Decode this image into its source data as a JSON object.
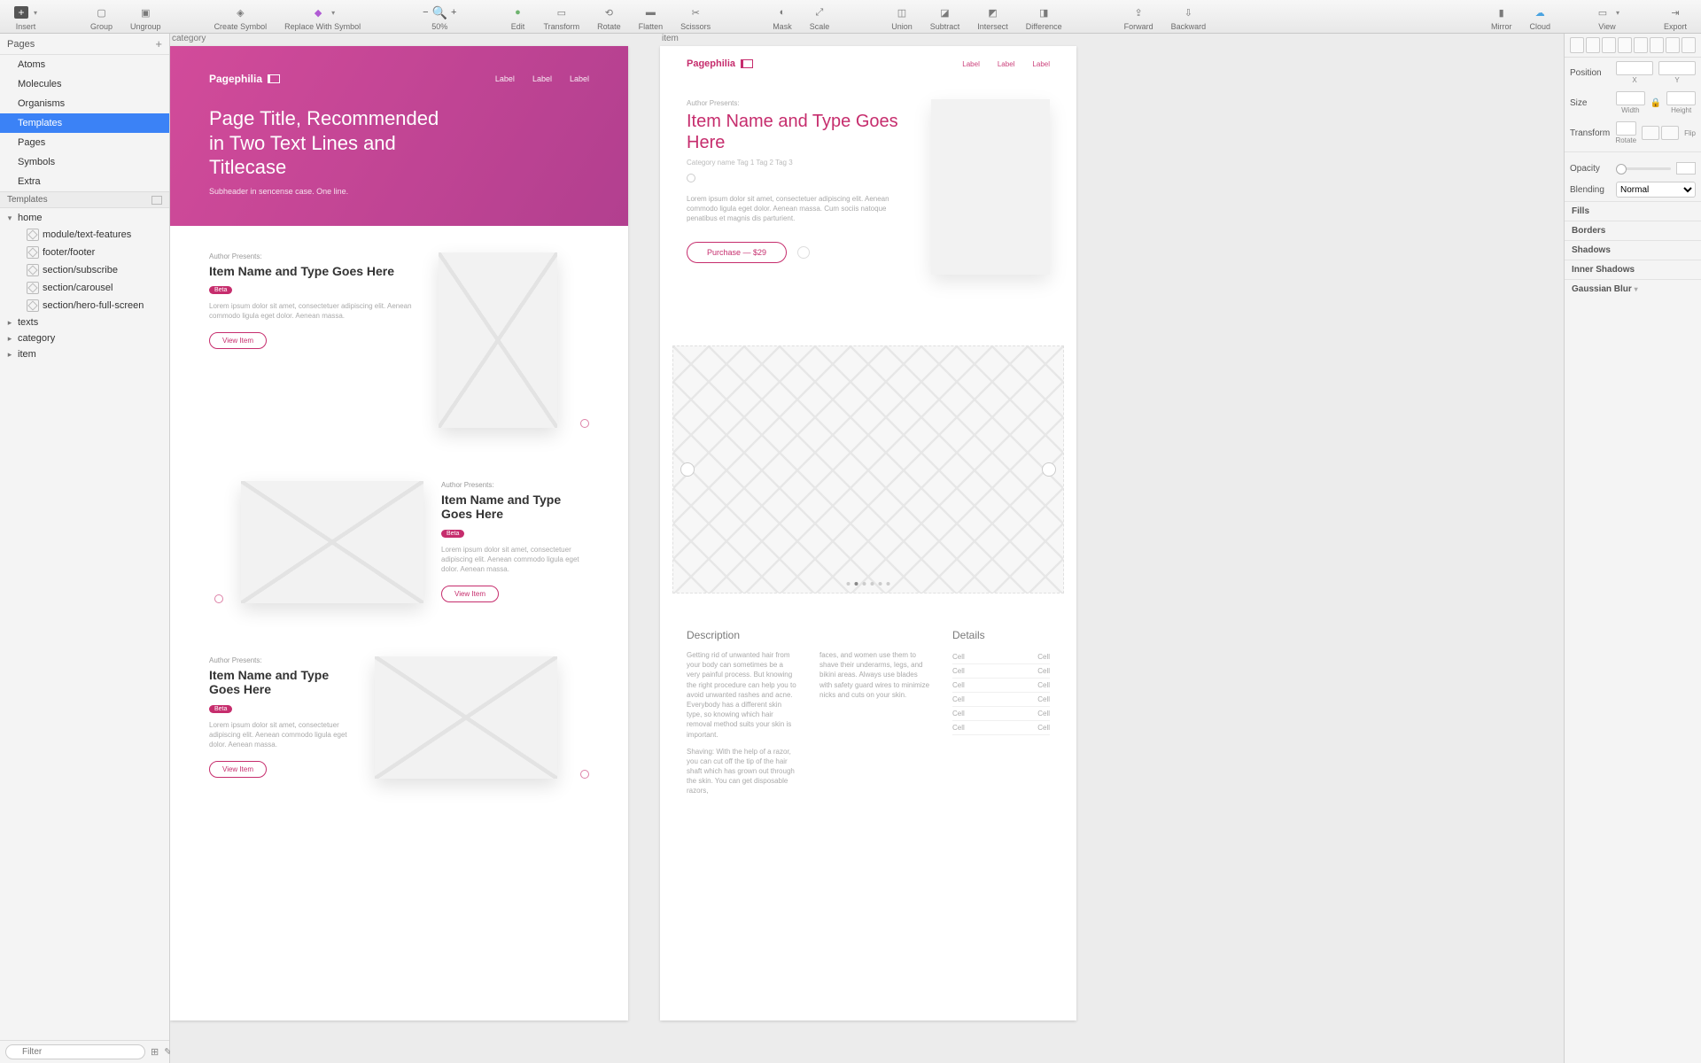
{
  "toolbar": {
    "insert": "Insert",
    "group": "Group",
    "ungroup": "Ungroup",
    "create_symbol": "Create Symbol",
    "replace_symbol": "Replace With Symbol",
    "zoom": "50%",
    "edit": "Edit",
    "transform": "Transform",
    "rotate": "Rotate",
    "flatten": "Flatten",
    "scissors": "Scissors",
    "mask": "Mask",
    "scale": "Scale",
    "union": "Union",
    "subtract": "Subtract",
    "intersect": "Intersect",
    "difference": "Difference",
    "forward": "Forward",
    "backward": "Backward",
    "mirror": "Mirror",
    "cloud": "Cloud",
    "view": "View",
    "export": "Export"
  },
  "pages_header": "Pages",
  "pages": [
    "Atoms",
    "Molecules",
    "Organisms",
    "Templates",
    "Pages",
    "Symbols",
    "Extra"
  ],
  "pages_selected": 3,
  "templates_header": "Templates",
  "tree": {
    "home": "home",
    "home_children": [
      "module/text-features",
      "footer/footer",
      "section/subscribe",
      "section/carousel",
      "section/hero-full-screen"
    ],
    "others": [
      "texts",
      "category",
      "item"
    ]
  },
  "filter_placeholder": "Filter",
  "filter_count": "4",
  "artboards": {
    "category": "category",
    "item": "item"
  },
  "canvas1": {
    "brand": "Pagephilia",
    "nav": [
      "Label",
      "Label",
      "Label"
    ],
    "title": "Page Title, Recommended in Two Text Lines and Titlecase",
    "sub": "Subheader in sencense case. One line.",
    "items": [
      {
        "eyebrow": "Author Presents:",
        "h": "Item Name and Type Goes Here",
        "badge": "Beta",
        "lorem": "Lorem ipsum dolor sit amet, consectetuer adipiscing elit. Aenean commodo ligula eget dolor. Aenean massa.",
        "btn": "View Item"
      },
      {
        "eyebrow": "Author Presents:",
        "h": "Item Name and Type Goes Here",
        "badge": "Beta",
        "lorem": "Lorem ipsum dolor sit amet, consectetuer adipiscing elit. Aenean commodo ligula eget dolor. Aenean massa.",
        "btn": "View Item"
      },
      {
        "eyebrow": "Author Presents:",
        "h": "Item Name and Type Goes Here",
        "badge": "Beta",
        "lorem": "Lorem ipsum dolor sit amet, consectetuer adipiscing elit. Aenean commodo ligula eget dolor. Aenean massa.",
        "btn": "View Item"
      }
    ]
  },
  "canvas2": {
    "brand": "Pagephilia",
    "nav": [
      "Label",
      "Label",
      "Label"
    ],
    "eyebrow": "Author Presents:",
    "h": "Item Name and Type Goes Here",
    "tags": "Category name   Tag 1   Tag 2   Tag 3",
    "lorem": "Lorem ipsum dolor sit amet, consectetuer adipiscing elit. Aenean commodo ligula eget dolor. Aenean massa. Cum sociis natoque penatibus et magnis dis parturient.",
    "buy": "Purchase — $29",
    "desc_h": "Description",
    "details_h": "Details",
    "p1": "Getting rid of unwanted hair from your body can sometimes be a very painful process. But knowing the right procedure can help you to avoid unwanted rashes and acne. Everybody has a different skin type, so knowing which hair removal method suits your skin is important.",
    "p2": "faces, and women use them to shave their underarms, legs, and bikini areas. Always use blades with safety guard wires to minimize nicks and cuts on your skin.",
    "p3": "Shaving: With the help of a razor, you can cut off the tip of the hair shaft which has grown out through the skin. You can get disposable razors,",
    "cell": "Cell"
  },
  "inspector": {
    "position": "Position",
    "x": "X",
    "y": "Y",
    "size": "Size",
    "width": "Width",
    "height": "Height",
    "transform": "Transform",
    "rotate": "Rotate",
    "flip": "Flip",
    "opacity": "Opacity",
    "blending": "Blending",
    "blend_val": "Normal",
    "fills": "Fills",
    "borders": "Borders",
    "shadows": "Shadows",
    "inner": "Inner Shadows",
    "blur": "Gaussian Blur"
  }
}
